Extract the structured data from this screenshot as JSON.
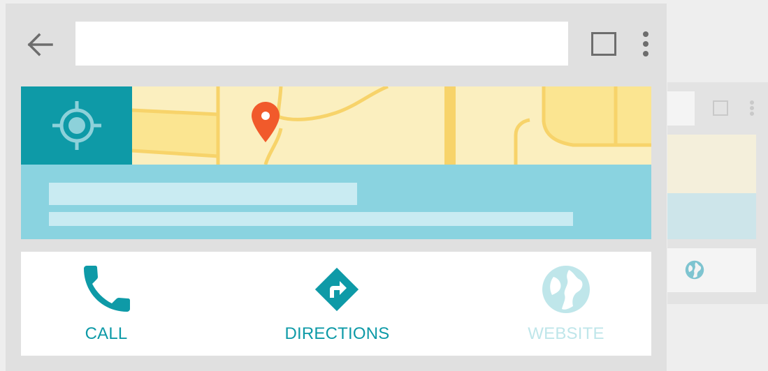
{
  "toolbar": {
    "search_value": "",
    "search_placeholder": ""
  },
  "actions": {
    "call_label": "CALL",
    "directions_label": "DIRECTIONS",
    "website_label": "WEBSITE"
  },
  "icons": {
    "back": "back-arrow-icon",
    "tabs": "tabs-square-icon",
    "menu": "overflow-menu-icon",
    "locate": "my-location-icon",
    "pin": "map-pin-icon",
    "call": "phone-icon",
    "directions": "directions-icon",
    "website": "globe-icon"
  },
  "colors": {
    "accent": "#0e9aa7",
    "map": "#fbefbf",
    "road": "#f7d36a",
    "pin": "#f15a2b",
    "info_panel": "#8ad3e0",
    "website_disabled": "#bfe6ea",
    "chrome": "#e0e0e0"
  }
}
